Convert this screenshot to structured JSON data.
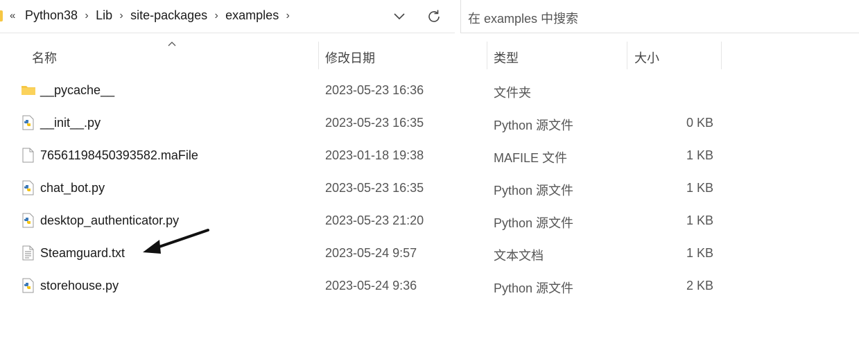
{
  "address": {
    "overflow": "«",
    "crumbs": [
      "Python38",
      "Lib",
      "site-packages",
      "examples"
    ],
    "separator": "›"
  },
  "search": {
    "placeholder": "在 examples 中搜索"
  },
  "columns": {
    "name": "名称",
    "date": "修改日期",
    "type": "类型",
    "size": "大小"
  },
  "files": [
    {
      "name": "__pycache__",
      "date": "2023-05-23 16:36",
      "type": "文件夹",
      "size": "",
      "icon": "folder-icon"
    },
    {
      "name": "__init__.py",
      "date": "2023-05-23 16:35",
      "type": "Python 源文件",
      "size": "0 KB",
      "icon": "python-file-icon"
    },
    {
      "name": "76561198450393582.maFile",
      "date": "2023-01-18 19:38",
      "type": "MAFILE 文件",
      "size": "1 KB",
      "icon": "file-icon"
    },
    {
      "name": "chat_bot.py",
      "date": "2023-05-23 16:35",
      "type": "Python 源文件",
      "size": "1 KB",
      "icon": "python-file-icon"
    },
    {
      "name": "desktop_authenticator.py",
      "date": "2023-05-23 21:20",
      "type": "Python 源文件",
      "size": "1 KB",
      "icon": "python-file-icon"
    },
    {
      "name": "Steamguard.txt",
      "date": "2023-05-24 9:57",
      "type": "文本文档",
      "size": "1 KB",
      "icon": "text-file-icon"
    },
    {
      "name": "storehouse.py",
      "date": "2023-05-24 9:36",
      "type": "Python 源文件",
      "size": "2 KB",
      "icon": "python-file-icon"
    }
  ],
  "colors": {
    "folder": "#f6c744",
    "python_blue": "#3d7ab8",
    "python_yellow": "#f5c518"
  }
}
